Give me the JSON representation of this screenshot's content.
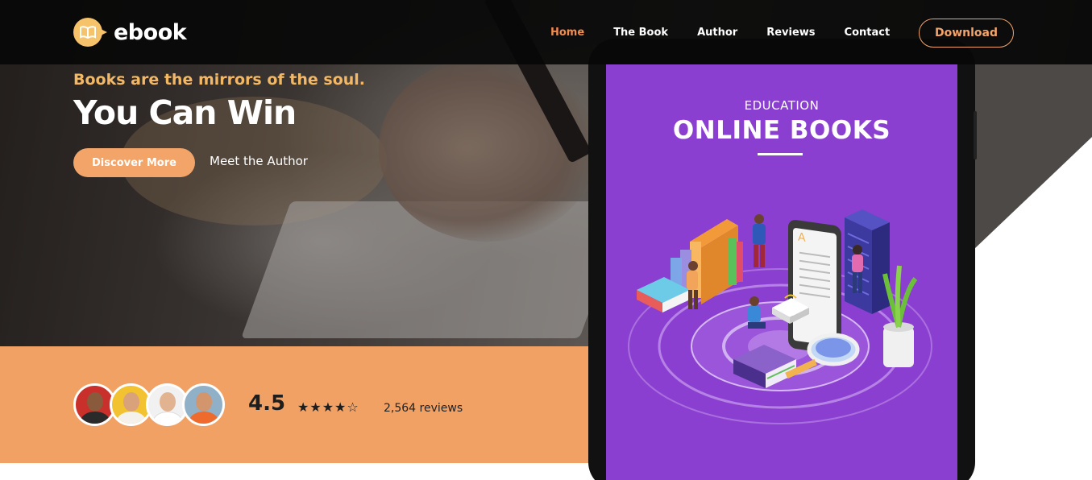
{
  "nav": {
    "logo_text": "ebook",
    "links": [
      {
        "label": "Home",
        "active": true
      },
      {
        "label": "The Book",
        "active": false
      },
      {
        "label": "Author",
        "active": false
      },
      {
        "label": "Reviews",
        "active": false
      },
      {
        "label": "Contact",
        "active": false
      }
    ],
    "download_label": "Download"
  },
  "hero": {
    "tagline": "Books are the mirrors of the soul.",
    "headline": "You Can Win",
    "discover_label": "Discover More",
    "author_label": "Meet the Author"
  },
  "stats": {
    "rating": "4.5",
    "stars": "★★★★☆",
    "rating_value": 4.5,
    "reviews": "2,564 reviews"
  },
  "screen": {
    "label": "EDUCATION",
    "title": "ONLINE BOOKS"
  },
  "colors": {
    "accent": "#f2a165",
    "nav_active": "#f08c4e",
    "tagline": "#f2b866",
    "screen_bg": "#8b3fd0"
  },
  "icons": [
    "book-logo-icon",
    "star-icon"
  ]
}
